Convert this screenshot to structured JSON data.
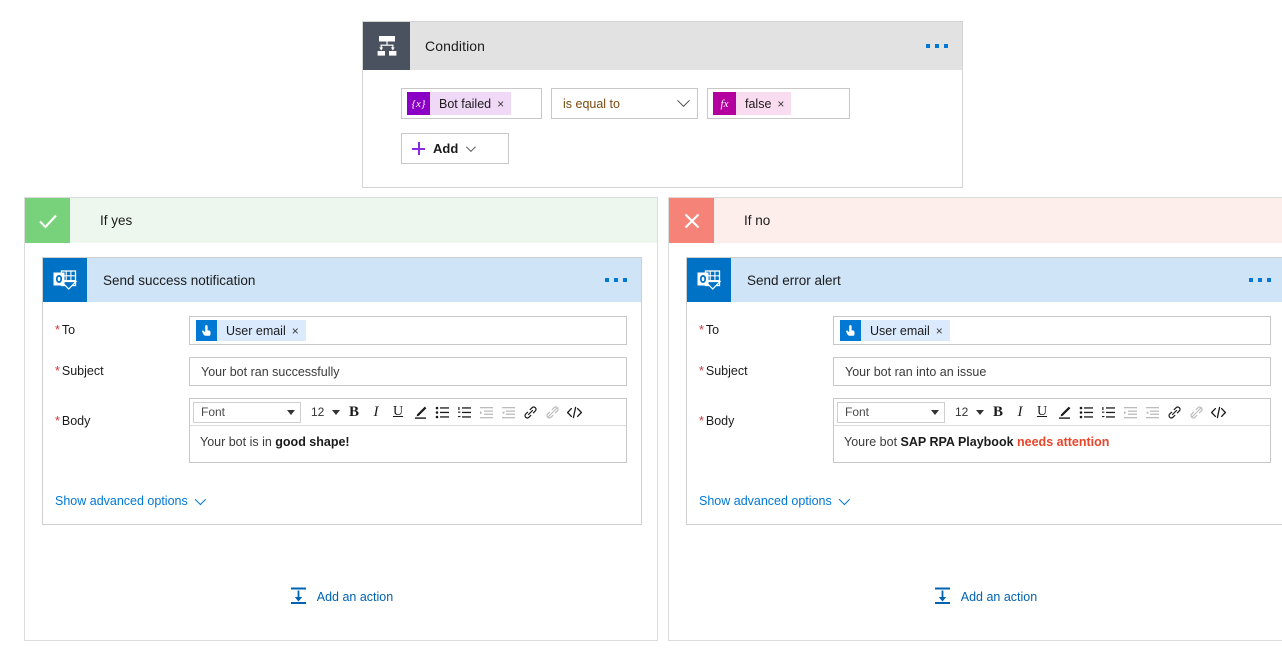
{
  "condition": {
    "icon": "condition-branch-icon",
    "title": "Condition",
    "menu_icon": "ellipsis-icon",
    "left_operand": {
      "badge": "{x}",
      "badge_icon": "dynamic-content-icon",
      "label": "Bot failed",
      "remove": "×",
      "badge_color": "#8a00c4",
      "chip_bg": "#f0d9f7"
    },
    "operator": {
      "value": "is equal to",
      "chevron": "chevron-down-icon"
    },
    "right_operand": {
      "badge": "fx",
      "badge_icon": "expression-icon",
      "label": "false",
      "remove": "×",
      "badge_color": "#b4009e",
      "chip_bg": "#fadcf0"
    },
    "add_button": {
      "label": "Add",
      "plus_icon": "plus-icon",
      "chevron": "chevron-down-icon"
    }
  },
  "branches": [
    {
      "key": "yes",
      "header": {
        "title": "If yes",
        "tile_icon": "checkmark-icon",
        "tile_color": "#78d27c",
        "header_bg": "#eef7ee"
      },
      "action": {
        "icon": "outlook-icon",
        "title": "Send success notification",
        "menu_icon": "ellipsis-icon",
        "fields": {
          "to": {
            "label": "To",
            "required": "*",
            "token_icon": "person-token-icon",
            "token_label": "User email",
            "token_remove": "×"
          },
          "subject": {
            "label": "Subject",
            "required": "*",
            "value": "Your bot ran successfully"
          },
          "body": {
            "label": "Body",
            "required": "*",
            "text_plain": "Your bot is in ",
            "text_bold": "good shape!"
          }
        },
        "toolbar": {
          "font": "Font",
          "size": "12",
          "bold": "B",
          "italic": "I",
          "underline": "U",
          "highlight_icon": "pen-highlight-icon",
          "bullet_list_icon": "bulleted-list-icon",
          "numbered_list_icon": "numbered-list-icon",
          "indent_decrease_icon": "decrease-indent-icon",
          "indent_increase_icon": "increase-indent-icon",
          "link_icon": "insert-link-icon",
          "unlink_icon": "remove-link-icon",
          "code_icon": "code-view-icon"
        },
        "advanced_link": {
          "label": "Show advanced options",
          "chevron": "chevron-down-icon"
        }
      },
      "add_action": {
        "label": "Add an action",
        "icon": "add-action-icon"
      }
    },
    {
      "key": "no",
      "header": {
        "title": "If no",
        "tile_icon": "close-x-icon",
        "tile_color": "#f58377",
        "header_bg": "#fdeeec"
      },
      "action": {
        "icon": "outlook-icon",
        "title": "Send error alert",
        "menu_icon": "ellipsis-icon",
        "fields": {
          "to": {
            "label": "To",
            "required": "*",
            "token_icon": "person-token-icon",
            "token_label": "User email",
            "token_remove": "×"
          },
          "subject": {
            "label": "Subject",
            "required": "*",
            "value": "Your bot ran into an issue"
          },
          "body": {
            "label": "Body",
            "required": "*",
            "text_plain": "Youre bot ",
            "text_bold": "SAP RPA Playbook",
            "text_red": "needs attention"
          }
        },
        "toolbar": {
          "font": "Font",
          "size": "12",
          "bold": "B",
          "italic": "I",
          "underline": "U",
          "highlight_icon": "pen-highlight-icon",
          "bullet_list_icon": "bulleted-list-icon",
          "numbered_list_icon": "numbered-list-icon",
          "indent_decrease_icon": "decrease-indent-icon",
          "indent_increase_icon": "increase-indent-icon",
          "link_icon": "insert-link-icon",
          "unlink_icon": "remove-link-icon",
          "code_icon": "code-view-icon"
        },
        "advanced_link": {
          "label": "Show advanced options",
          "chevron": "chevron-down-icon"
        }
      },
      "add_action": {
        "label": "Add an action",
        "icon": "add-action-icon"
      }
    }
  ]
}
